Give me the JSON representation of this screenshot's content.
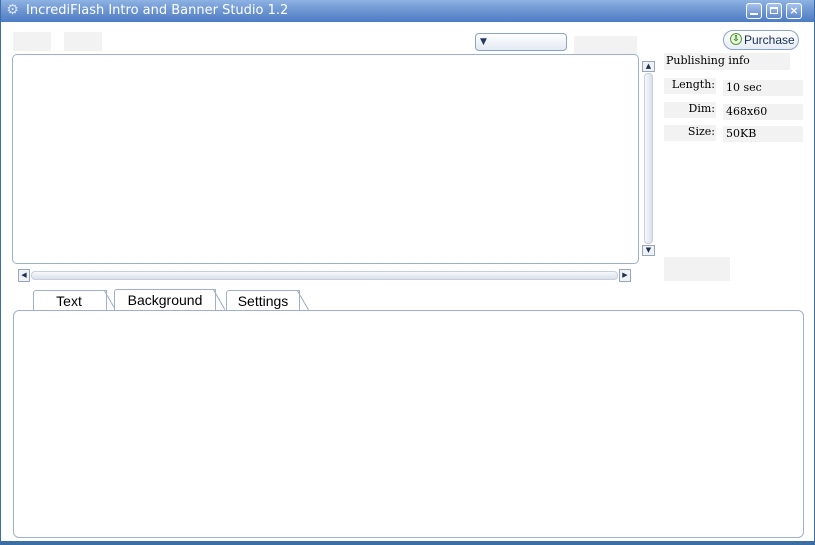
{
  "window": {
    "title": "IncrediFlash Intro and Banner Studio 1.2",
    "app_icon": "gear-icon",
    "controls": [
      "minimize",
      "maximize",
      "close"
    ]
  },
  "toolbar": {
    "purchase_label": "Purchase",
    "purchase_icon": "download-arrow-icon",
    "dropdown_value": ""
  },
  "publishing_info": {
    "title": "Publishing info",
    "rows": [
      {
        "label": "Length:",
        "value": "10 sec"
      },
      {
        "label": "Dim:",
        "value": "468x60"
      },
      {
        "label": "Size:",
        "value": "50KB"
      }
    ]
  },
  "tabs": [
    {
      "label": "Text"
    },
    {
      "label": "Background"
    },
    {
      "label": "Settings"
    }
  ],
  "colors": {
    "titlebar": "#5d87c8",
    "border": "#9fb1c9",
    "placeholder": "#f2f2f2"
  }
}
